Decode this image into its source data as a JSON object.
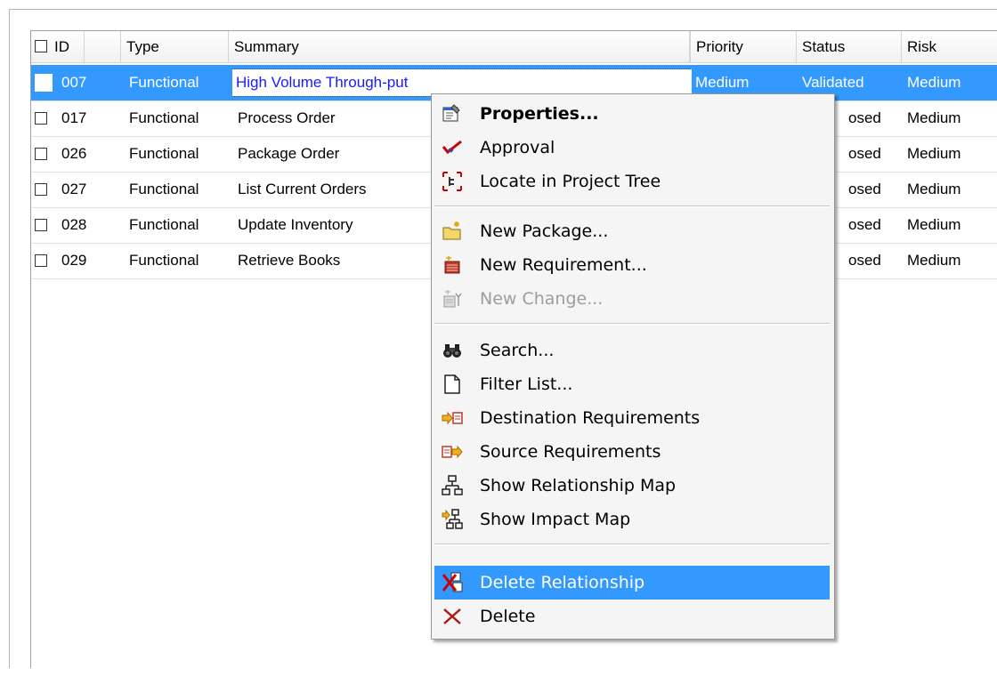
{
  "columns": {
    "id": "ID",
    "type": "Type",
    "summary": "Summary",
    "priority": "Priority",
    "status": "Status",
    "risk": "Risk"
  },
  "rows": [
    {
      "id": "007",
      "type": "Functional",
      "summary": "High Volume Through-put",
      "priority": "Medium",
      "status": "Validated",
      "risk": "Medium",
      "selected": true
    },
    {
      "id": "017",
      "type": "Functional",
      "summary": "Process Order",
      "status": "osed",
      "risk": "Medium"
    },
    {
      "id": "026",
      "type": "Functional",
      "summary": "Package Order",
      "status": "osed",
      "risk": "Medium"
    },
    {
      "id": "027",
      "type": "Functional",
      "summary": "List Current Orders",
      "status": "osed",
      "risk": "Medium"
    },
    {
      "id": "028",
      "type": "Functional",
      "summary": "Update Inventory",
      "status": "osed",
      "risk": "Medium"
    },
    {
      "id": "029",
      "type": "Functional",
      "summary": "Retrieve Books",
      "status": "osed",
      "risk": "Medium"
    }
  ],
  "context_menu": {
    "items": [
      {
        "label": "Properties...",
        "icon": "properties-icon"
      },
      {
        "label": "Approval",
        "icon": "approval-check-icon"
      },
      {
        "label": "Locate in Project Tree",
        "icon": "locate-tree-icon"
      },
      {
        "label": "New Package...",
        "icon": "new-package-icon"
      },
      {
        "label": "New Requirement...",
        "icon": "new-requirement-icon"
      },
      {
        "label": "New Change...",
        "icon": "new-change-icon",
        "disabled": true
      },
      {
        "label": "Search...",
        "icon": "binoculars-icon"
      },
      {
        "label": "Filter List...",
        "icon": "filter-page-icon"
      },
      {
        "label": "Destination Requirements",
        "icon": "destination-arrow-icon"
      },
      {
        "label": "Source Requirements",
        "icon": "source-arrow-icon"
      },
      {
        "label": "Show Relationship Map",
        "icon": "relationship-map-icon"
      },
      {
        "label": "Show Impact Map",
        "icon": "impact-map-icon"
      },
      {
        "label": "Delete Relationship",
        "icon": "delete-relationship-icon",
        "highlighted": true
      },
      {
        "label": "Delete",
        "icon": "delete-x-icon"
      }
    ]
  },
  "colors": {
    "selection": "#3399ff",
    "focus_text": "#1a1aff",
    "approval_red": "#cc0000"
  }
}
